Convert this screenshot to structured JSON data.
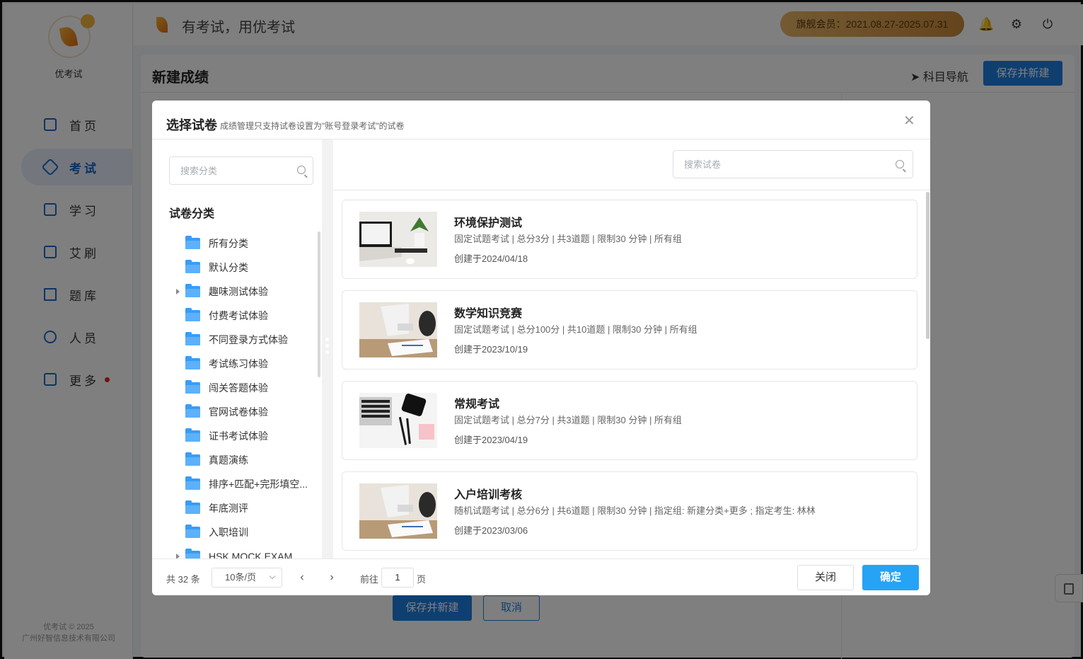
{
  "app": {
    "logo_name": "优考试",
    "slogan": "有考试，用优考试",
    "member_badge": "旗舰会员：2021.08.27-2025.07.31",
    "copyright_line1": "优考试 © 2025",
    "copyright_line2": "广州好智信息技术有限公司"
  },
  "sidebar": {
    "items": [
      {
        "label": "首页",
        "icon": "home-icon",
        "active": false
      },
      {
        "label": "考试",
        "icon": "exam-icon",
        "active": true
      },
      {
        "label": "学习",
        "icon": "book-icon",
        "active": false
      },
      {
        "label": "艾刷",
        "icon": "quiz-icon",
        "active": false
      },
      {
        "label": "题库",
        "icon": "chart-icon",
        "active": false
      },
      {
        "label": "人员",
        "icon": "user-icon",
        "active": false
      },
      {
        "label": "更多",
        "icon": "apps-icon",
        "active": false
      }
    ]
  },
  "page": {
    "title": "新建成绩",
    "subject_nav": "科目导航",
    "save_new": "保存并新建",
    "bottom_save": "保存并新建",
    "bottom_cancel": "取消"
  },
  "modal": {
    "title": "选择试卷",
    "subtitle": "成绩管理只支持试卷设置为\"账号登录考试\"的试卷",
    "category_search_placeholder": "搜索分类",
    "category_title": "试卷分类",
    "categories": [
      {
        "label": "所有分类",
        "expandable": false
      },
      {
        "label": "默认分类",
        "expandable": false
      },
      {
        "label": "趣味测试体验",
        "expandable": true
      },
      {
        "label": "付费考试体验",
        "expandable": false
      },
      {
        "label": "不同登录方式体验",
        "expandable": false
      },
      {
        "label": "考试练习体验",
        "expandable": false
      },
      {
        "label": "闯关答题体验",
        "expandable": false
      },
      {
        "label": "官网试卷体验",
        "expandable": false
      },
      {
        "label": "证书考试体验",
        "expandable": false
      },
      {
        "label": "真题演练",
        "expandable": false
      },
      {
        "label": "排序+匹配+完形填空...",
        "expandable": false
      },
      {
        "label": "年底测评",
        "expandable": false
      },
      {
        "label": "入职培训",
        "expandable": false
      },
      {
        "label": "HSK MOCK EXAM",
        "expandable": true
      }
    ],
    "paper_search_placeholder": "搜索试卷",
    "papers": [
      {
        "title": "环境保护测试",
        "meta": "固定试题考试 | 总分3分 | 共3道题 | 限制30 分钟 | 所有组",
        "date": "创建于2024/04/18",
        "thumb": "laptop-plant"
      },
      {
        "title": "数学知识竞赛",
        "meta": "固定试题考试 | 总分100分 | 共10道题 | 限制30 分钟 | 所有组",
        "date": "创建于2023/10/19",
        "thumb": "desk-writing"
      },
      {
        "title": "常规考试",
        "meta": "固定试题考试 | 总分7分 | 共3道题 | 限制30 分钟 | 所有组",
        "date": "创建于2023/04/19",
        "thumb": "keyboard-phone"
      },
      {
        "title": "入户培训考核",
        "meta": "随机试题考试 | 总分6分 | 共6道题 | 限制30 分钟 | 指定组: 新建分类+更多 ; 指定考生: 林林",
        "date": "创建于2023/03/06",
        "thumb": "desk-writing"
      }
    ],
    "footer": {
      "total": "共 32 条",
      "page_size": "10条/页",
      "goto": "前往",
      "page": "1",
      "page_unit": "页",
      "close": "关闭",
      "confirm": "确定"
    }
  }
}
